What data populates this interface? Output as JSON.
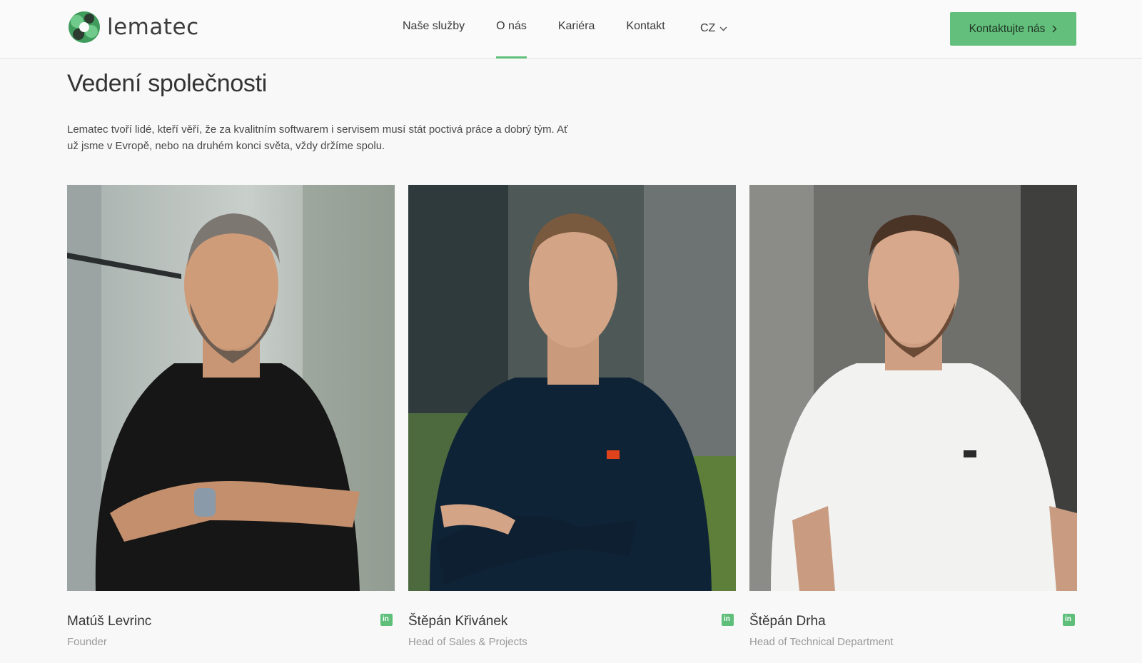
{
  "brand": {
    "name": "lematec",
    "accent": "#63bf7c"
  },
  "nav": {
    "items": [
      {
        "label": "Naše služby",
        "active": false
      },
      {
        "label": "O nás",
        "active": true
      },
      {
        "label": "Kariéra",
        "active": false
      },
      {
        "label": "Kontakt",
        "active": false
      }
    ],
    "language": "CZ",
    "cta": "Kontaktujte nás"
  },
  "section": {
    "title": "Vedení společnosti",
    "intro": "Lematec tvoří lidé, kteří věří, že za kvalitním softwarem i servisem musí stát poctivá práce a dobrý tým. Ať už jsme v Evropě, nebo na druhém konci světa, vždy držíme spolu."
  },
  "team": [
    {
      "name": "Matúš Levrinc",
      "role": "Founder",
      "icon": "linkedin-icon"
    },
    {
      "name": "Štěpán Křivánek",
      "role": "Head of Sales & Projects",
      "icon": "linkedin-icon"
    },
    {
      "name": "Štěpán Drha",
      "role": "Head of Technical Department",
      "icon": "linkedin-icon"
    }
  ]
}
